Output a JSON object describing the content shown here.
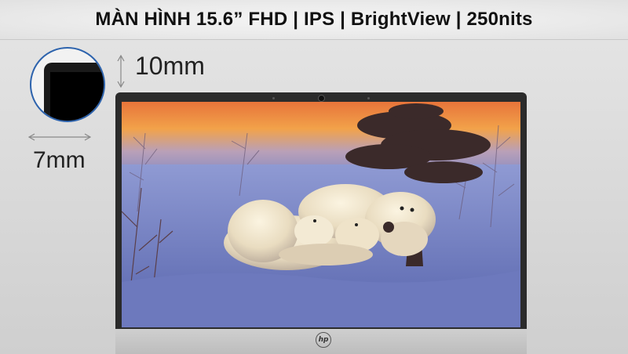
{
  "header": {
    "title": "MÀN HÌNH 15.6” FHD | IPS | BrightView | 250nits"
  },
  "dimensions": {
    "top_bezel": "10mm",
    "side_bezel": "7mm"
  },
  "brand": {
    "logo_text": "hp"
  },
  "colors": {
    "accent": "#2d63ad",
    "bezel": "#2b2b2b",
    "chassis": "#c8c8c8"
  }
}
